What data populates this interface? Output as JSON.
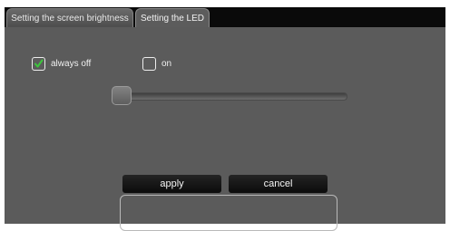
{
  "tabs": [
    {
      "label": "Setting the screen brightness",
      "active": false
    },
    {
      "label": "Setting the LED",
      "active": true
    }
  ],
  "options": {
    "always_off": {
      "label": "always off",
      "checked": true
    },
    "on": {
      "label": "on",
      "checked": false
    }
  },
  "slider": {
    "value": 0
  },
  "buttons": {
    "apply": "apply",
    "cancel": "cancel"
  },
  "colors": {
    "check_mark": "#3cc63c",
    "panel": "#5b5b5b",
    "tab_bar": "#0a0a0a"
  }
}
